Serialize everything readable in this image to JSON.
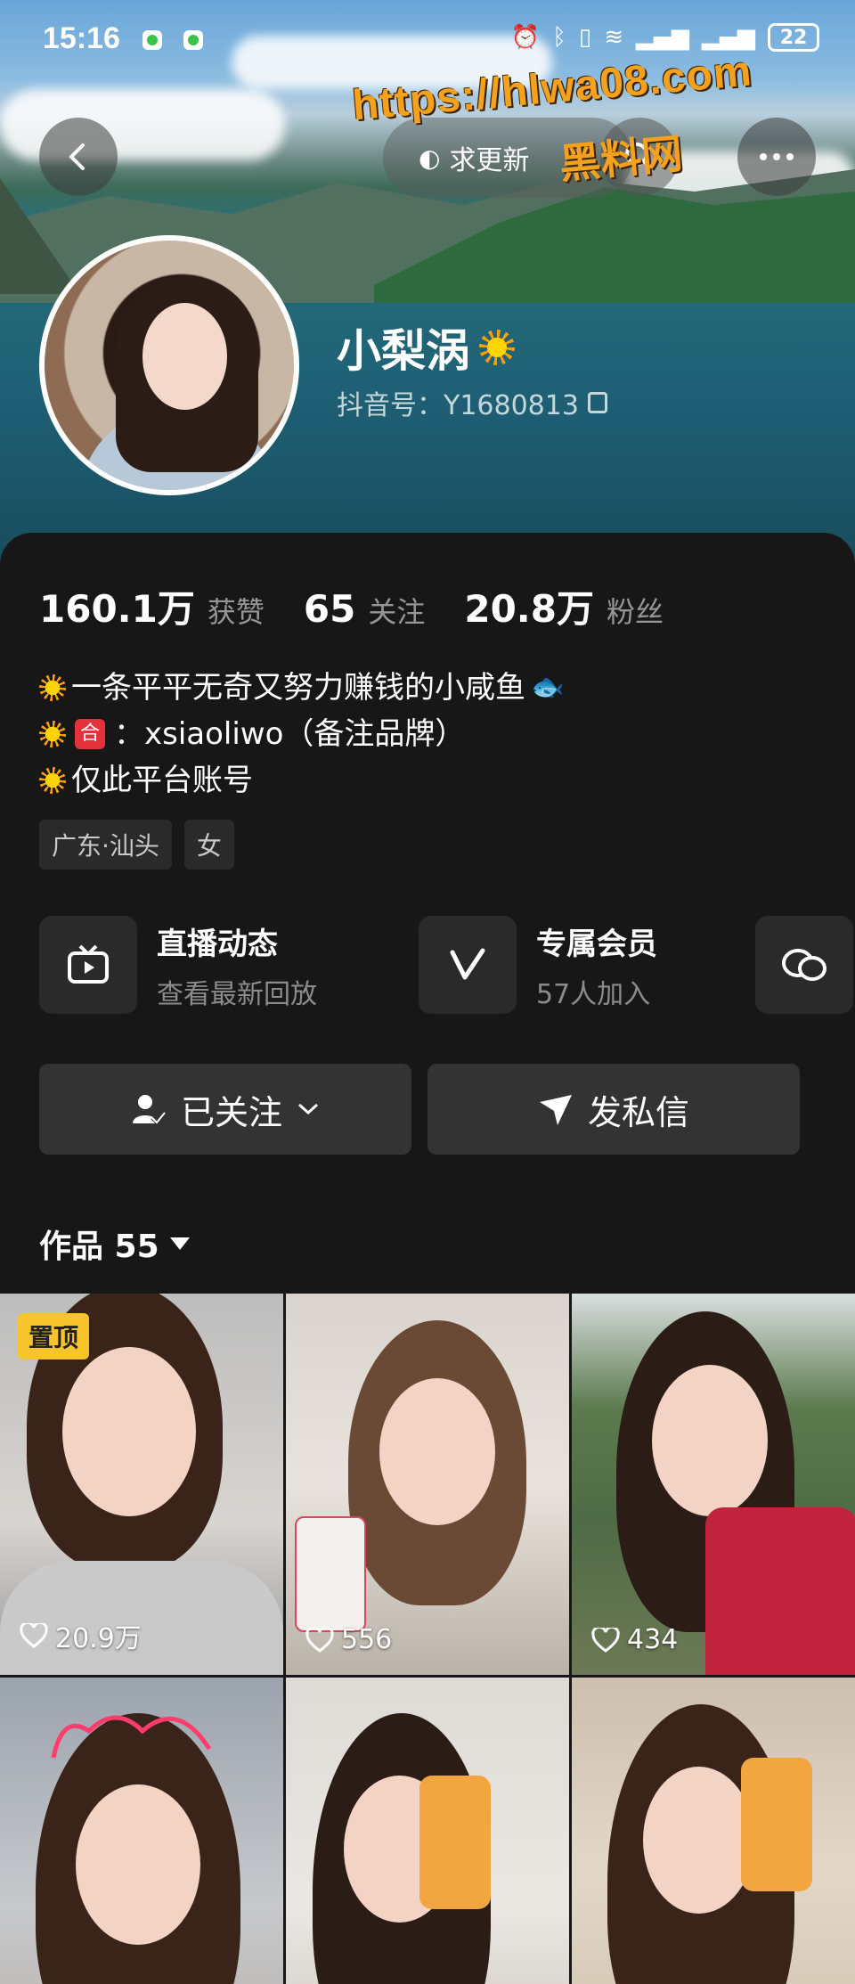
{
  "status_bar": {
    "time": "15:16",
    "battery": "22"
  },
  "header": {
    "update_label": "求更新"
  },
  "watermark": {
    "url": "https://hlwa08.com",
    "site": "黑料网"
  },
  "profile": {
    "name": "小梨涡",
    "douyin_id": "抖音号：Y1680813"
  },
  "stats": [
    {
      "value": "160.1万",
      "label": "获赞"
    },
    {
      "value": "65",
      "label": "关注"
    },
    {
      "value": "20.8万",
      "label": "粉丝"
    }
  ],
  "bio": {
    "line1": "一条平平无奇又努力赚钱的小咸鱼",
    "badge": "合",
    "line2": "：xsiaoliwo（备注品牌）",
    "line3": "仅此平台账号"
  },
  "tags": [
    "广东·汕头",
    "女"
  ],
  "features": [
    {
      "title": "直播动态",
      "subtitle": "查看最新回放",
      "icon": "tv-icon"
    },
    {
      "title": "专属会员",
      "subtitle": "57人加入",
      "icon": "v-icon"
    },
    {
      "icon": "chat-icon"
    }
  ],
  "actions": {
    "follow_label": "已关注",
    "message_label": "发私信"
  },
  "works": {
    "title": "作品 55",
    "pinned_label": "置顶",
    "items": [
      {
        "likes": "20.9万"
      },
      {
        "likes": "556"
      },
      {
        "likes": "434"
      },
      {
        "likes": ""
      },
      {
        "likes": ""
      },
      {
        "likes": ""
      }
    ]
  }
}
